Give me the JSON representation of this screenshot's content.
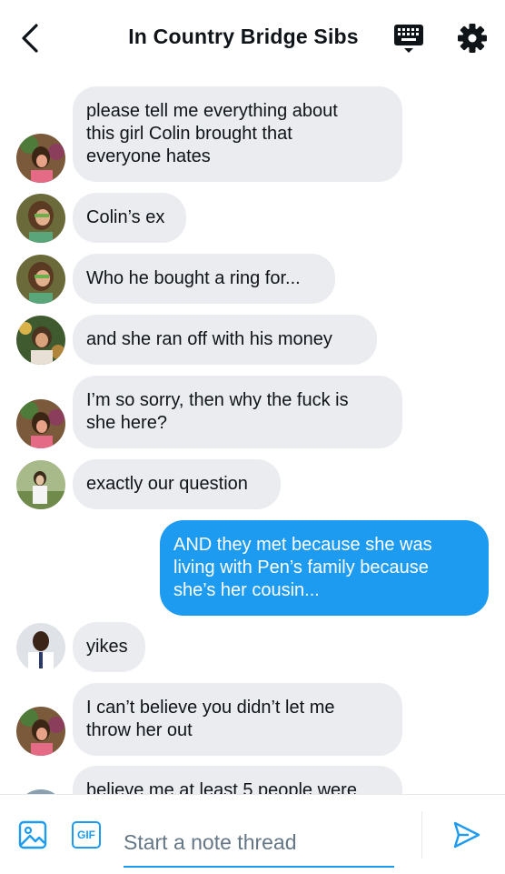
{
  "header": {
    "title": "In Country Bridge Sibs"
  },
  "messages": [
    {
      "text": "please tell me everything about\nthis girl Colin brought that\neveryone hates",
      "avatar": "avatar-a"
    },
    {
      "text": "Colin’s ex",
      "avatar": "avatar-a"
    },
    {
      "text": "Who he bought a ring for...",
      "avatar": "avatar-a"
    },
    {
      "text": "and she ran off with his money",
      "avatar": "avatar-b"
    },
    {
      "text": "I’m so sorry, then why the fuck is\nshe here?",
      "avatar": "avatar-a"
    },
    {
      "text": "exactly our question",
      "avatar": "avatar-c"
    },
    {
      "text": "AND they met because she was\nliving with Pen’s family because\nshe’s her cousin...",
      "mine": true
    },
    {
      "text": "yikes",
      "avatar": "avatar-d"
    },
    {
      "text": "I can’t believe you didn’t let me\nthrow her out",
      "avatar": "avatar-a"
    },
    {
      "text": "believe me at least 5 people were",
      "avatar": "avatar-e"
    }
  ],
  "composer": {
    "placeholder": "Start a note thread",
    "gif_label": "GIF"
  },
  "colors": {
    "accent": "#1d9bf0",
    "bubble": "#eaecf0"
  },
  "icons": [
    "back-arrow-icon",
    "keyboard-icon",
    "gear-icon",
    "image-icon",
    "gif-icon",
    "send-icon"
  ]
}
